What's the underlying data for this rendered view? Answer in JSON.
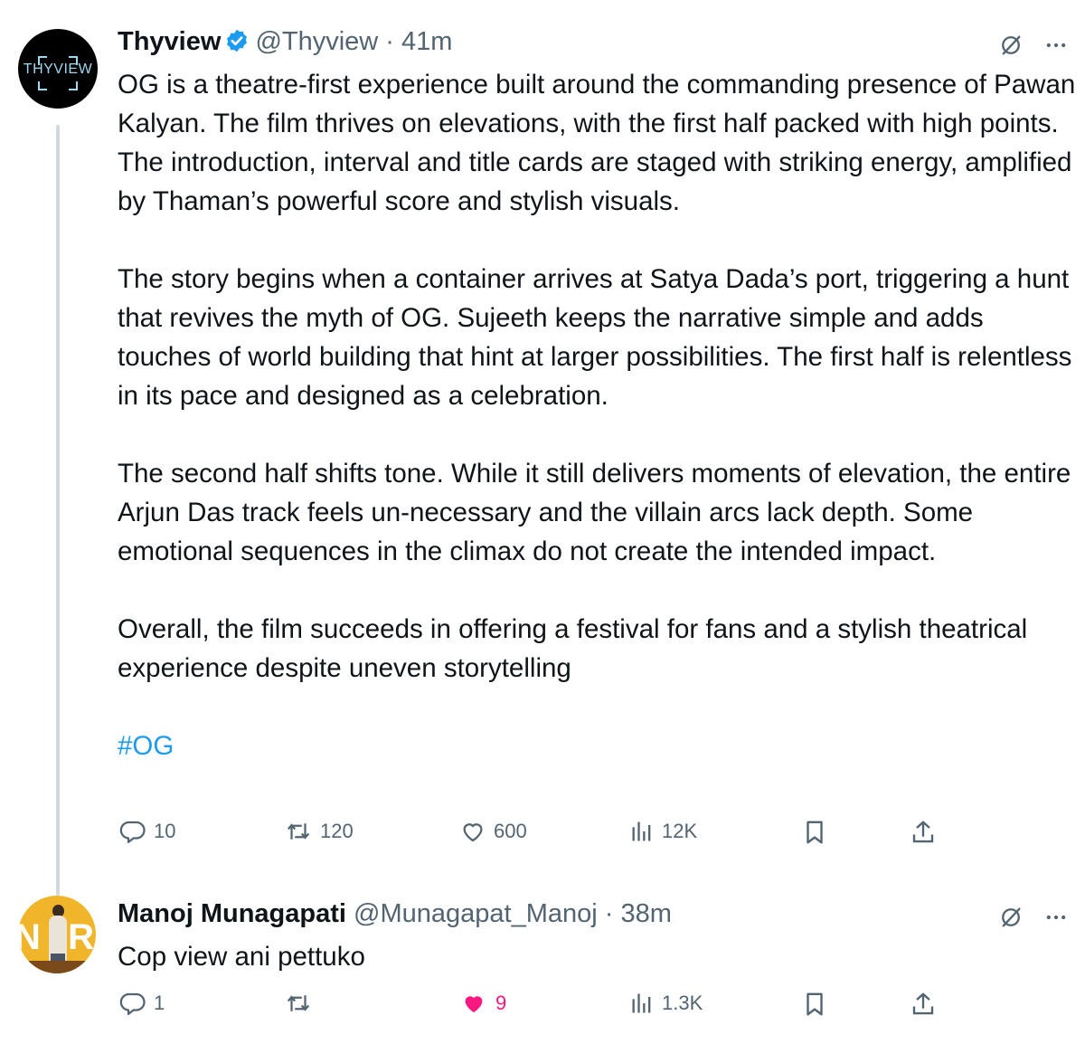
{
  "tweet1": {
    "name": "Thyview",
    "handle": "@Thyview",
    "separator": " · ",
    "time": "41m",
    "avatar_text": "THYVIEW",
    "paragraphs": [
      "OG is a theatre-first experience built around the commanding presence of Pawan Kalyan. The film thrives on elevations, with the first half packed with high points. The introduction, interval and title cards are staged with striking energy, amplified by Thaman’s powerful score and stylish visuals.",
      "The story begins when a container arrives at Satya Dada’s port, triggering a hunt that revives the myth of OG. Sujeeth keeps the narrative simple and adds touches of world building that hint at larger possibilities. The first half is relentless in its pace and designed as a celebration.",
      "The second half shifts tone. While it still delivers moments of elevation, the entire Arjun Das track feels un-necessary and the villain arcs lack depth. Some emotional sequences in the climax do not create the intended impact.",
      "Overall, the film succeeds in offering a festival for fans and a stylish theatrical experience despite uneven storytelling"
    ],
    "hashtag": "#OG",
    "replies": "10",
    "reposts": "120",
    "likes": "600",
    "views": "12K"
  },
  "tweet2": {
    "name": "Manoj Munagapati",
    "handle": "@Munagapat_Manoj",
    "separator": " · ",
    "time": "38m",
    "avatar_letters_left": "N",
    "avatar_letters_right": "R",
    "text": "Cop view ani pettuko",
    "replies": "1",
    "likes": "9",
    "views": "1.3K"
  },
  "colors": {
    "accent": "#1d9bf0",
    "muted": "#536471",
    "like_active": "#f91880",
    "text": "#0f1419"
  },
  "icons": [
    "verified-badge-icon",
    "grok-icon",
    "more-icon",
    "reply-icon",
    "repost-icon",
    "like-icon",
    "views-icon",
    "bookmark-icon",
    "share-icon"
  ]
}
